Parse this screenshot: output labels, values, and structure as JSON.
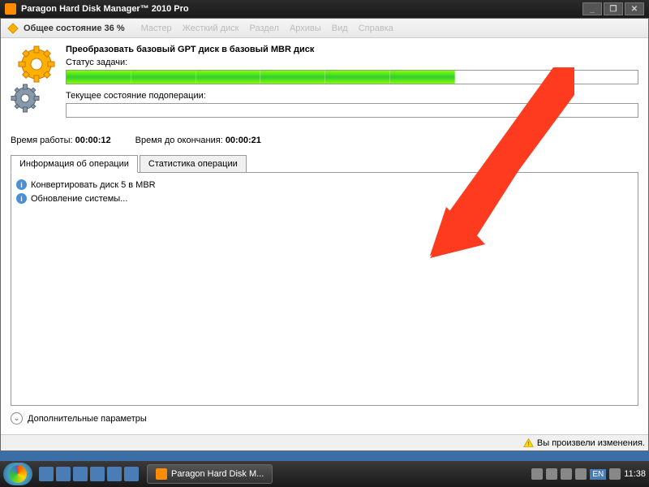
{
  "titlebar": {
    "title": "Paragon Hard Disk Manager™ 2010 Pro"
  },
  "toolbar": {
    "status_label": "Общее состояние 36 %",
    "menu": {
      "wizard": "Мастер",
      "disk": "Жесткий диск",
      "partition": "Раздел",
      "archives": "Архивы",
      "view": "Вид",
      "help": "Справка"
    }
  },
  "task": {
    "title": "Преобразовать базовый GPT диск в базовый MBR диск",
    "status_label": "Статус задачи:",
    "progress_main_pct": 68,
    "substatus_label": "Текущее состояние подоперации:",
    "progress_sub_pct": 0
  },
  "times": {
    "elapsed_label": "Время работы:",
    "elapsed": "00:00:12",
    "remaining_label": "Время до окончания:",
    "remaining": "00:00:21"
  },
  "tabs": {
    "info": "Информация об операции",
    "stats": "Статистика операции"
  },
  "operations": [
    "Конвертировать диск 5 в MBR",
    "Обновление системы..."
  ],
  "extra_params_label": "Дополнительные параметры",
  "statusbar": {
    "warning": "Вы произвели изменения."
  },
  "taskbar": {
    "app_label": "Paragon Hard Disk M...",
    "lang": "EN",
    "clock": "11:38"
  },
  "colors": {
    "progress_green": "#32cd32",
    "arrow_red": "#ff3b1f"
  }
}
